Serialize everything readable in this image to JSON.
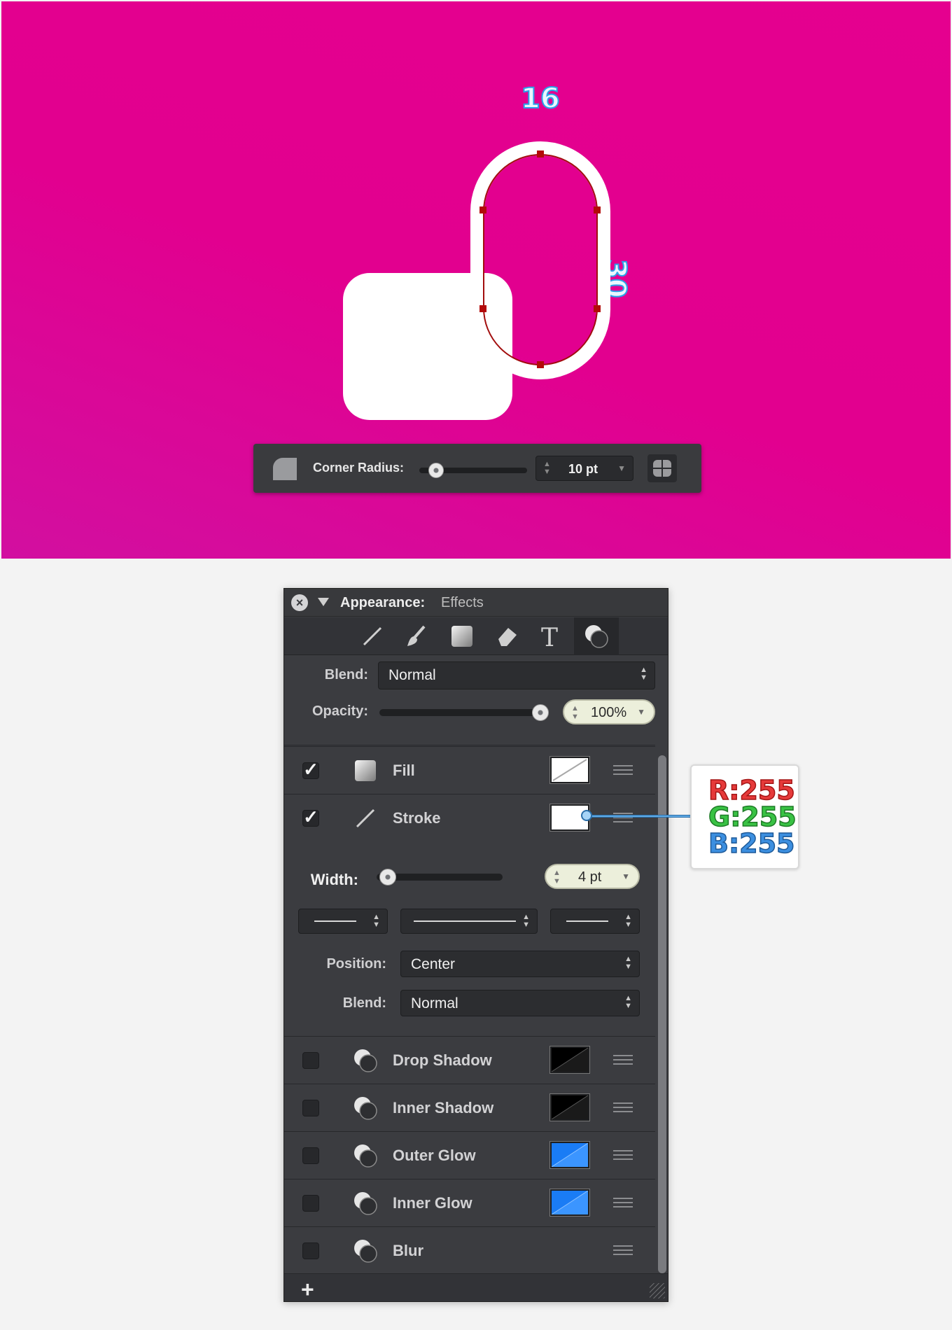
{
  "canvas": {
    "background": "#e2008f",
    "dimension_width": "16",
    "dimension_height": "30",
    "corner_radius_bar": {
      "label": "Corner Radius:",
      "value": "10 pt",
      "slider_level": 0.12
    }
  },
  "panel": {
    "title": "Appearance:",
    "subtitle": "Effects",
    "tabs": [
      "line-tool-icon",
      "brush-icon",
      "fill-square-icon",
      "eraser-icon",
      "text-icon",
      "effects-circles-icon"
    ],
    "blend": {
      "label": "Blend:",
      "value": "Normal"
    },
    "opacity": {
      "label": "Opacity:",
      "value": "100%",
      "level": 1.0
    },
    "layers": [
      {
        "label": "Fill",
        "checked": true,
        "icon": "fill-square-icon"
      },
      {
        "label": "Stroke",
        "checked": true,
        "icon": "line-tool-icon"
      }
    ],
    "stroke": {
      "width_label": "Width:",
      "width_value": "4 pt",
      "width_level": 0.04,
      "position_label": "Position:",
      "position_value": "Center",
      "blend_label": "Blend:",
      "blend_value": "Normal"
    },
    "effects": [
      {
        "label": "Drop Shadow",
        "color": "#000000"
      },
      {
        "label": "Inner Shadow",
        "color": "#000000"
      },
      {
        "label": "Outer Glow",
        "color": "#1a7cf5"
      },
      {
        "label": "Inner Glow",
        "color": "#1a7cf5"
      },
      {
        "label": "Blur",
        "color": ""
      }
    ],
    "add_label": "+"
  },
  "callout": {
    "r": "R:255",
    "g": "G:255",
    "b": "B:255"
  }
}
